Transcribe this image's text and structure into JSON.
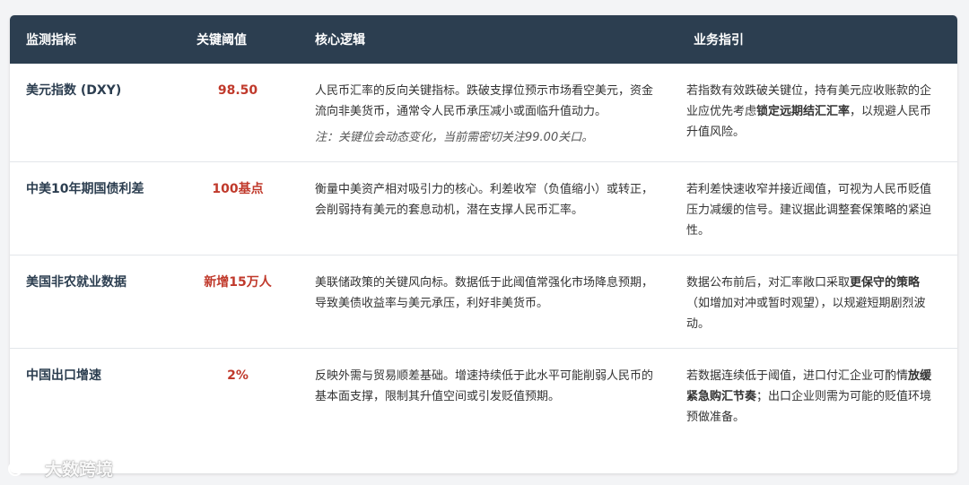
{
  "headers": {
    "metric": "监测指标",
    "threshold": "关键阈值",
    "logic": "核心逻辑",
    "guidance": "业务指引"
  },
  "rows": [
    {
      "metric": "美元指数 (DXY)",
      "threshold": "98.50",
      "logic": "人民币汇率的反向关键指标。跌破支撑位预示市场看空美元，资金流向非美货币，通常令人民币承压减小或面临升值动力。",
      "note": "注：关键位会动态变化，当前需密切关注99.00关口。",
      "guide_pre": "若指数有效跌破关键位，持有美元应收账款的企业应优先考虑",
      "guide_bold": "锁定远期结汇汇率",
      "guide_post": "，以规避人民币升值风险。"
    },
    {
      "metric": "中美10年期国债利差",
      "threshold": "100基点",
      "logic": "衡量中美资产相对吸引力的核心。利差收窄（负值缩小）或转正，会削弱持有美元的套息动机，潜在支撑人民币汇率。",
      "note": "",
      "guide_pre": "若利差快速收窄并接近阈值，可视为人民币贬值压力减缓的信号。建议据此调整套保策略的紧迫性。",
      "guide_bold": "",
      "guide_post": ""
    },
    {
      "metric": "美国非农就业数据",
      "threshold": "新增15万人",
      "logic": "美联储政策的关键风向标。数据低于此阈值常强化市场降息预期，导致美债收益率与美元承压，利好非美货币。",
      "note": "",
      "guide_pre": "数据公布前后，对汇率敞口采取",
      "guide_bold": "更保守的策略",
      "guide_post": "（如增加对冲或暂时观望），以规避短期剧烈波动。"
    },
    {
      "metric": "中国出口增速",
      "threshold": "2%",
      "logic": "反映外需与贸易顺差基础。增速持续低于此水平可能削弱人民币的基本面支撑，限制其升值空间或引发贬值预期。",
      "note": "",
      "guide_pre": "若数据连续低于阈值，进口付汇企业可酌情",
      "guide_bold": "放缓紧急购汇节奏",
      "guide_post": "；出口企业则需为可能的贬值环境预做准备。"
    }
  ],
  "watermark": "大数跨境",
  "colors": {
    "header_bg": "#2c3e50",
    "threshold": "#c0392b",
    "metric": "#2c3e50"
  }
}
